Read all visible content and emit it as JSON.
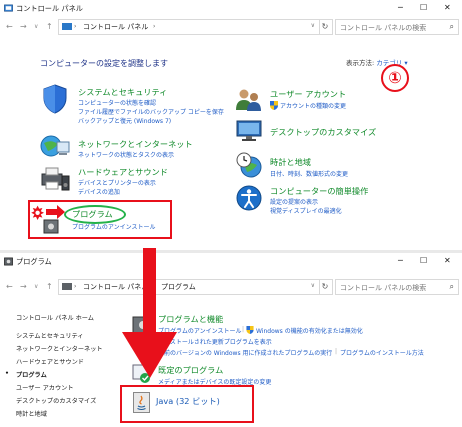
{
  "window1": {
    "title": "コントロール パネル",
    "address": "コントロール パネル",
    "search_placeholder": "コントロール パネルの検索",
    "heading": "コンピューターの設定を調整します",
    "view_by_label": "表示方法:",
    "view_by_value": "カテゴリ",
    "annotation": "①",
    "categories": [
      {
        "title": "システムとセキュリティ",
        "links": [
          "コンピューターの状態を確認",
          "ファイル履歴でファイルのバックアップ コピーを保存",
          "バックアップと復元 (Windows 7)"
        ]
      },
      {
        "title": "ネットワークとインターネット",
        "links": [
          "ネットワークの状態とタスクの表示"
        ]
      },
      {
        "title": "ハードウェアとサウンド",
        "links": [
          "デバイスとプリンターの表示",
          "デバイスの追加"
        ]
      },
      {
        "title": "プログラム",
        "links": [
          "プログラムのアンインストール"
        ]
      },
      {
        "title": "ユーザー アカウント",
        "links": [
          "アカウントの種類の変更"
        ]
      },
      {
        "title": "デスクトップのカスタマイズ",
        "links": []
      },
      {
        "title": "時計と地域",
        "links": [
          "日付、時刻、数値形式の変更"
        ]
      },
      {
        "title": "コンピューターの簡単操作",
        "links": [
          "設定の提案の表示",
          "視覚ディスプレイの最適化"
        ]
      }
    ]
  },
  "window2": {
    "title": "プログラム",
    "address_parts": [
      "コントロール パネル",
      "プログラム"
    ],
    "search_placeholder": "コントロール パネルの検索",
    "sidebar": [
      "コントロール パネル ホーム",
      "システムとセキュリティ",
      "ネットワークとインターネット",
      "ハードウェアとサウンド",
      "プログラム",
      "ユーザー アカウント",
      "デスクトップのカスタマイズ",
      "時計と地域"
    ],
    "section1_title": "プログラムと機能",
    "section1_links": [
      "プログラムのアンインストール",
      "Windows の機能の有効化または無効化",
      "インストールされた更新プログラムを表示",
      "以前のバージョンの Windows 用に作成されたプログラムの実行",
      "プログラムのインストール方法"
    ],
    "section2_title": "既定のプログラム",
    "section2_links": [
      "メディアまたはデバイスの既定設定の変更"
    ],
    "java_label": "Java (32 ビット)"
  },
  "colors": {
    "annotation_red": "#e8101b",
    "annotation_green": "#24b24a",
    "category_green": "#108a2a",
    "link_blue": "#1e5bc6"
  }
}
